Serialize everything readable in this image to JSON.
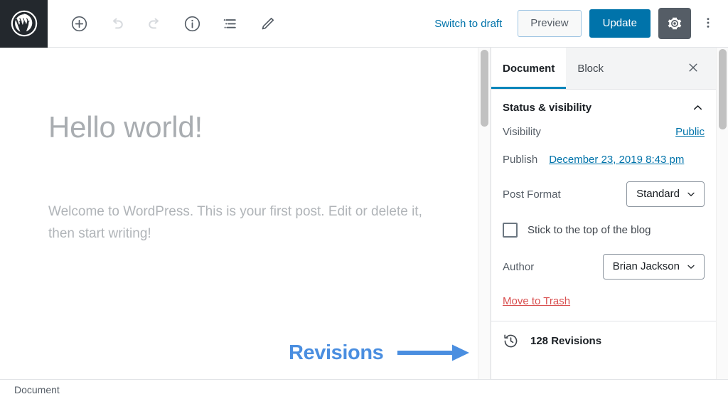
{
  "header": {
    "logo_icon": "wordpress-logo-icon",
    "tools": [
      {
        "name": "add-block-button",
        "icon": "plus-circle-icon",
        "disabled": false
      },
      {
        "name": "undo-button",
        "icon": "undo-icon",
        "disabled": true
      },
      {
        "name": "redo-button",
        "icon": "redo-icon",
        "disabled": true
      },
      {
        "name": "content-info-button",
        "icon": "info-circle-icon",
        "disabled": false
      },
      {
        "name": "block-navigation-button",
        "icon": "list-view-icon",
        "disabled": false
      },
      {
        "name": "edit-mode-button",
        "icon": "pencil-icon",
        "disabled": false
      }
    ],
    "switch_to_draft_label": "Switch to draft",
    "preview_label": "Preview",
    "update_label": "Update",
    "settings_icon": "gear-icon",
    "more_menu_icon": "ellipsis-vertical-icon",
    "accent_blue": "#0073aa",
    "gear_bg": "#555d66"
  },
  "editor": {
    "title": "Hello world!",
    "body": "Welcome to WordPress. This is your first post. Edit or delete it, then start writing!"
  },
  "sidebar": {
    "tabs": [
      {
        "label": "Document",
        "active": true
      },
      {
        "label": "Block",
        "active": false
      }
    ],
    "close_icon": "close-icon",
    "panel": {
      "title": "Status & visibility",
      "collapse_icon": "chevron-up-icon",
      "visibility": {
        "label": "Visibility",
        "value": "Public"
      },
      "publish": {
        "label": "Publish",
        "value": "December 23, 2019 8:43 pm"
      },
      "post_format": {
        "label": "Post Format",
        "value": "Standard",
        "dropdown_icon": "chevron-down-icon"
      },
      "sticky": {
        "label": "Stick to the top of the blog",
        "checked": false
      },
      "author": {
        "label": "Author",
        "value": "Brian Jackson",
        "dropdown_icon": "chevron-down-icon"
      },
      "trash_label": "Move to Trash",
      "trash_color": "#d94f4f"
    },
    "revisions": {
      "icon": "history-clock-icon",
      "label": "128 Revisions"
    }
  },
  "bottom_bar": {
    "breadcrumb": "Document"
  },
  "annotation": {
    "text": "Revisions",
    "color": "#4a8ee0",
    "arrow_icon": "arrow-right-icon"
  }
}
